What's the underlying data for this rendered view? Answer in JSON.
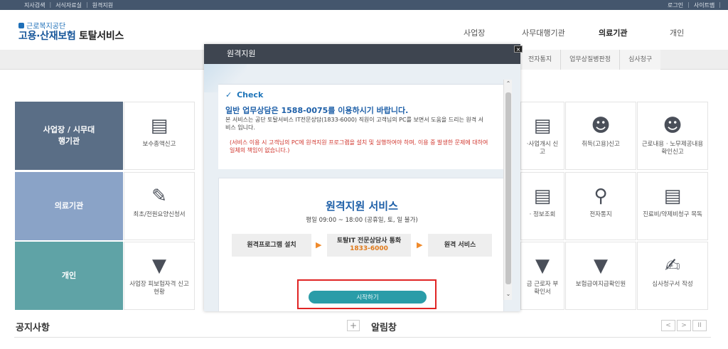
{
  "topbar": {
    "left_links": [
      "지사검색",
      "서식자료실",
      "원격지원"
    ],
    "right_links": [
      "로그인",
      "사이트맵"
    ],
    "separator": "|"
  },
  "header": {
    "org_name": "근로복지공단",
    "site_title_blue": "고용·산재보험",
    "site_title_black": "토탈서비스",
    "nav": [
      "사업장",
      "사무대행기관",
      "의료기관",
      "개인"
    ],
    "active_nav": "의료기관"
  },
  "subtabs": [
    "전자통지",
    "업무상질병판정",
    "심사청구"
  ],
  "categories": [
    "사업장 / 시무대행기관",
    "의료기관",
    "개인"
  ],
  "tiles": {
    "row1_left": "보수총액신고",
    "row1_right": [
      "·사업개시 신고",
      "취득(고용)신고",
      "근로내용 · 노무제공내용 확인신고"
    ],
    "row2_left": "최초/전원요양신청서",
    "row2_right": [
      "· 정보조회",
      "전자통지",
      "진료비/약제비청구 목독"
    ],
    "row3_left": "사업장 피보험자격 신고현황",
    "row3_right": [
      "금 근로자 부 확인서",
      "보험급여지급확인원",
      "심사청구서 작성"
    ]
  },
  "bottom": {
    "notice_title": "공지사항",
    "plus": "+",
    "alert_title": "알림창",
    "pager": [
      "<",
      ">",
      "II"
    ]
  },
  "modal": {
    "title": "원격지원",
    "close": "×",
    "check_label": "Check",
    "line1": "일반 업무상담은 1588-0075를 이용하시기 바랍니다.",
    "line2": "본 서비스는 공단 토탈서비스 IT전문상담(1833-6000) 직원이 고객님의 PC를 보면서 도움을 드리는 원격 서비스 입니다.",
    "warning": "(서비스 이용 시 고객님의 PC에 원격지원 프로그램을 설치 및 실행하여야 하며, 이용 중 발생한 문제에 대하여 일체의 책임이 없습니다.)",
    "service_title": "원격지원 서비스",
    "hours": "평일 09:00 ~ 18:00 (공휴일, 토, 일 불가)",
    "step1": "원격프로그램 설치",
    "step2_label": "토탈IT 전문상담사 통화",
    "step2_phone": "1833-6000",
    "step3": "원격 서비스",
    "arrow": "▶",
    "start_button": "시작하기"
  },
  "colors": {
    "topbar": "#44566d",
    "modal_header": "#3e4550",
    "accent_blue": "#1d5fa8",
    "start_button": "#2a9ca8",
    "highlight_red": "#e02424"
  }
}
